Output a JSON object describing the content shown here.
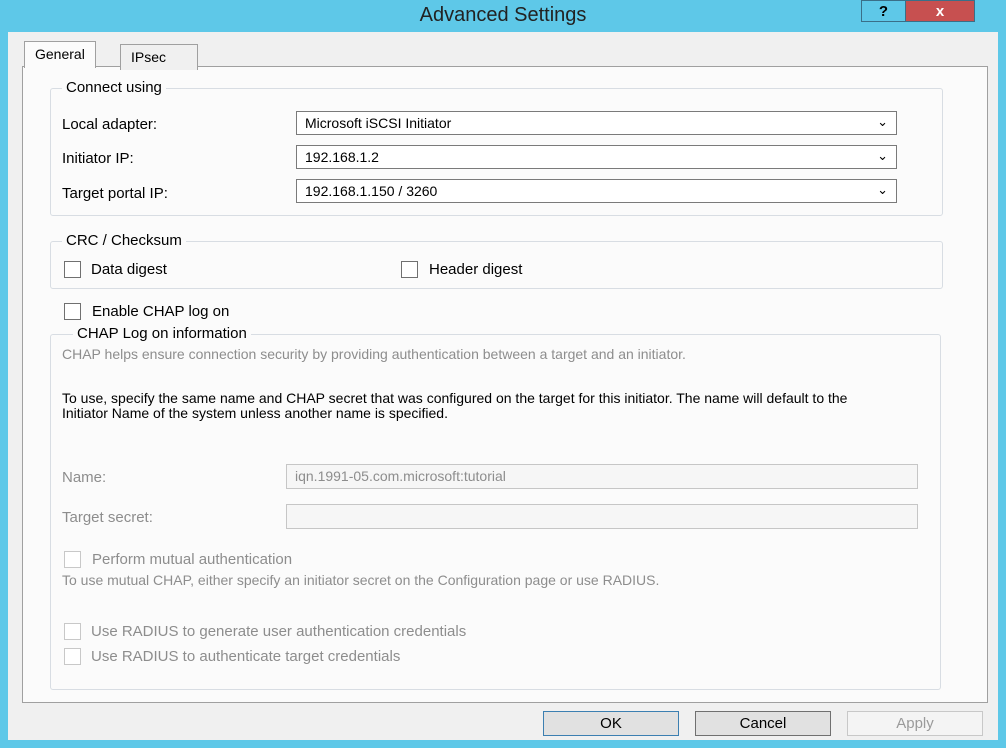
{
  "window": {
    "title": "Advanced Settings",
    "help_label": "?",
    "close_label": "x"
  },
  "tabs": [
    {
      "label": "General",
      "active": true
    },
    {
      "label": "IPsec",
      "active": false
    }
  ],
  "connect": {
    "group_label": "Connect using",
    "local_adapter": {
      "label": "Local adapter:",
      "value": "Microsoft iSCSI Initiator"
    },
    "initiator_ip": {
      "label": "Initiator IP:",
      "value": "192.168.1.2"
    },
    "target_portal": {
      "label": "Target portal IP:",
      "value": "192.168.1.150 / 3260"
    }
  },
  "crc": {
    "group_label": "CRC / Checksum",
    "data_digest": "Data digest",
    "header_digest": "Header digest"
  },
  "chap": {
    "enable_label": "Enable CHAP log on",
    "group_label": "CHAP Log on information",
    "desc1": "CHAP helps ensure connection security by providing authentication between a target and an initiator.",
    "desc2": "To use, specify the same name and CHAP secret that was configured on the target for this initiator.  The name will default to the Initiator Name of the system unless another name is specified.",
    "name_label": "Name:",
    "name_value": "iqn.1991-05.com.microsoft:tutorial",
    "secret_label": "Target secret:",
    "secret_value": "",
    "mutual_label": "Perform mutual authentication",
    "mutual_desc": "To use mutual CHAP, either specify an initiator secret on the Configuration page or use RADIUS.",
    "radius_gen": "Use RADIUS to generate user authentication credentials",
    "radius_auth": "Use RADIUS to authenticate target credentials"
  },
  "buttons": {
    "ok": "OK",
    "cancel": "Cancel",
    "apply": "Apply"
  },
  "chevron": "⌄"
}
